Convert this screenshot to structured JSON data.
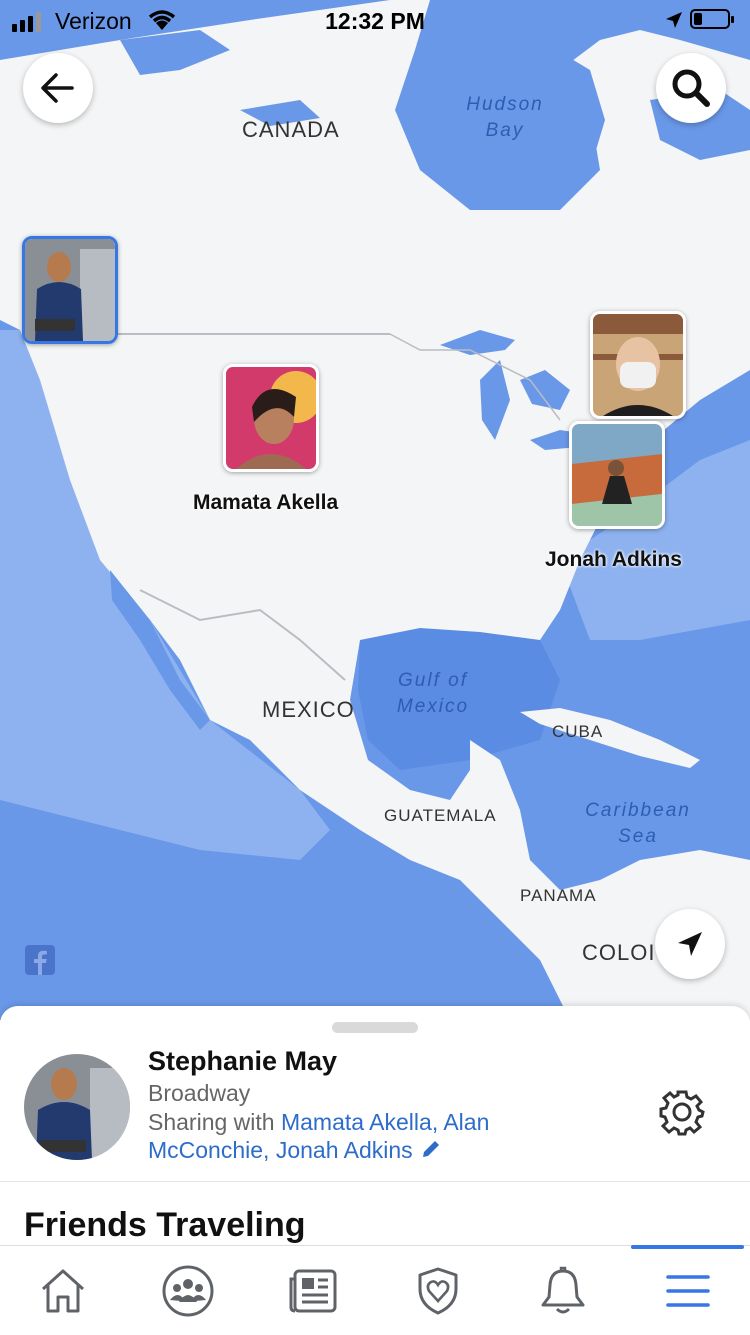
{
  "status_bar": {
    "carrier": "Verizon",
    "time": "12:32 PM"
  },
  "map": {
    "labels": {
      "canada": "CANADA",
      "hudson_bay_line1": "Hudson",
      "hudson_bay_line2": "Bay",
      "mexico": "MEXICO",
      "gulf_line1": "Gulf of",
      "gulf_line2": "Mexico",
      "cuba": "CUBA",
      "guatemala": "GUATEMALA",
      "caribbean_line1": "Caribbean",
      "caribbean_line2": "Sea",
      "panama": "PANAMA",
      "colombia": "COLOІ"
    },
    "friends": [
      {
        "name": "Mamata Akella"
      },
      {
        "name": "Jonah Adkins"
      }
    ],
    "colors": {
      "ocean": "#6a98e8",
      "land": "#f4f5f6",
      "shallow": "#8db2ef"
    }
  },
  "sheet": {
    "name": "Stephanie May",
    "location": "Broadway",
    "sharing_prefix": "Sharing with ",
    "sharing_names": "Mamata Akella, Alan McConchie, Jonah Adkins",
    "section_title": "Friends Traveling"
  },
  "tabs": [
    {
      "icon": "home-icon"
    },
    {
      "icon": "groups-icon"
    },
    {
      "icon": "news-feed-icon"
    },
    {
      "icon": "shield-heart-icon"
    },
    {
      "icon": "bell-icon"
    },
    {
      "icon": "menu-icon",
      "active": true
    }
  ],
  "accent_color": "#3577e5"
}
